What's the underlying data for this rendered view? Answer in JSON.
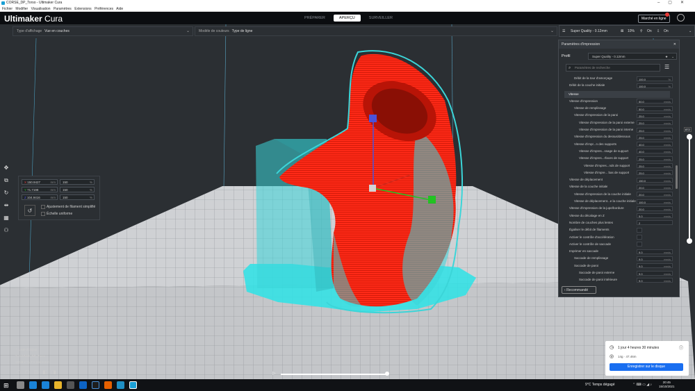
{
  "window": {
    "title": "CORSE_DP_Torso - Ultimaker Cura"
  },
  "menu": [
    "Fichier",
    "Modifier",
    "Visualisation",
    "Paramètres",
    "Extensions",
    "Préférences",
    "Aide"
  ],
  "header": {
    "logo_bold": "Ultimaker",
    "logo_light": " Cura",
    "stages": [
      "PRÉPARER",
      "APERÇU",
      "SURVEILLER"
    ],
    "active_stage": "APERÇU",
    "marketplace": "Marché en ligne"
  },
  "viewbar": {
    "type_label": "Type d'affichage",
    "type_value": "Vue en couches",
    "color_label": "Modèle de couleurs",
    "color_value": "Type de ligne"
  },
  "printbar": {
    "quality": "Super Quality - 0.12mm",
    "infill": "10%",
    "support": "On",
    "adhesion": "On"
  },
  "scale": {
    "x_value": "150.9427",
    "y_value": "71.7198",
    "z_value": "104.9416",
    "unit_mm": "mm",
    "pct": "150",
    "unit_pct": "%",
    "snap_label": "Ajustement de filament simplifié",
    "uniform_label": "Échelle uniforme"
  },
  "settings": {
    "title": "Paramètres d'impression",
    "profile_label": "Profil",
    "profile_value": "Super Quality - 0.12mm",
    "search_placeholder": "Paramètres de recherche",
    "rows": [
      {
        "label": "Débit de la tour d'amorçage",
        "value": "100.0",
        "unit": "%",
        "indent": 2
      },
      {
        "label": "Débit de la couche initiale",
        "value": "100.0",
        "unit": "%",
        "indent": 1
      },
      {
        "label": "Vitesse",
        "section": true
      },
      {
        "label": "Vitesse d'impression",
        "value": "50.0",
        "unit": "mm/s",
        "indent": 1
      },
      {
        "label": "Vitesse de remplissage",
        "value": "50.0",
        "unit": "mm/s",
        "indent": 2
      },
      {
        "label": "Vitesse d'impression de la paroi",
        "value": "25.0",
        "unit": "mm/s",
        "indent": 2
      },
      {
        "label": "Vitesse d'impression de la paroi externe",
        "value": "25.0",
        "unit": "mm/s",
        "indent": 3
      },
      {
        "label": "Vitesse d'impression de la paroi interne",
        "value": "25.0",
        "unit": "mm/s",
        "indent": 3
      },
      {
        "label": "Vitesse d'impression du dessus/dessous",
        "value": "25.0",
        "unit": "mm/s",
        "indent": 2
      },
      {
        "label": "Vitesse d'impr...n des supports",
        "value": "40.0",
        "unit": "mm/s",
        "indent": 2
      },
      {
        "label": "Vitesse d'impres...ssage de support",
        "value": "40.0",
        "unit": "mm/s",
        "indent": 3
      },
      {
        "label": "Vitesse d'impres...rfaces de support",
        "value": "25.0",
        "unit": "mm/s",
        "indent": 3
      },
      {
        "label": "Vitesse d'impres...nds de support",
        "value": "25.0",
        "unit": "mm/s",
        "indent": 4
      },
      {
        "label": "Vitesse d'impre... bas de support",
        "value": "25.0",
        "unit": "mm/s",
        "indent": 4
      },
      {
        "label": "Vitesse de déplacement",
        "value": "150.0",
        "unit": "mm/s",
        "indent": 1
      },
      {
        "label": "Vitesse de la couche initiale",
        "value": "20.0",
        "unit": "mm/s",
        "indent": 1
      },
      {
        "label": "Vitesse d'impression de la couche initiale",
        "value": "20.0",
        "unit": "mm/s",
        "indent": 2
      },
      {
        "label": "Vitesse de déplacement...e la couche initiale",
        "value": "100.0",
        "unit": "mm/s",
        "indent": 2
      },
      {
        "label": "Vitesse d'impression de la jupe/bordure",
        "value": "20.0",
        "unit": "mm/s",
        "indent": 1
      },
      {
        "label": "Vitesse du décalage en Z",
        "value": "5.0",
        "unit": "mm/s",
        "indent": 1
      },
      {
        "label": "Nombre de couches plus lentes",
        "value": "2",
        "unit": "",
        "indent": 1
      },
      {
        "label": "Égaliser le débit de filaments",
        "check": true,
        "indent": 1
      },
      {
        "label": "Activer le contrôle d'accélération",
        "check": true,
        "indent": 1
      },
      {
        "label": "Activer le contrôle de saccade",
        "check": true,
        "indent": 1
      },
      {
        "label": "Imprimer en saccade",
        "value": "9.0",
        "unit": "mm/s",
        "indent": 1
      },
      {
        "label": "Saccade de remplissage",
        "value": "9.0",
        "unit": "mm/s",
        "indent": 2
      },
      {
        "label": "Saccade de paroi",
        "value": "9.0",
        "unit": "mm/s",
        "indent": 2
      },
      {
        "label": "Saccade de paroi externe",
        "value": "9.0",
        "unit": "mm/s",
        "indent": 3
      },
      {
        "label": "Saccade de paroi intérieure",
        "value": "9.0",
        "unit": "mm/s",
        "indent": 3
      },
      {
        "label": "Saccade de dessus/dessous",
        "value": "9.0",
        "unit": "mm/s",
        "indent": 2
      }
    ],
    "recommended": "Recommandé"
  },
  "layer": {
    "current": "872"
  },
  "object": {
    "list_label": "Liste d'objets",
    "name": "CORSE_DP_Torso",
    "dims": "150.9 x 71.7 x 104.9 mm"
  },
  "estimate": {
    "time": "1 jour 4 heures 30 minutes",
    "material": "14g · 47.46m",
    "save_label": "Enregistrer sur le disque"
  },
  "taskbar": {
    "weather": "9°C  Temps dégagé",
    "time": "20:45",
    "date": "15/10/2021"
  },
  "colors": {
    "accent": "#196ef0",
    "model": "#ff2a17",
    "support": "#3bd5d8"
  }
}
